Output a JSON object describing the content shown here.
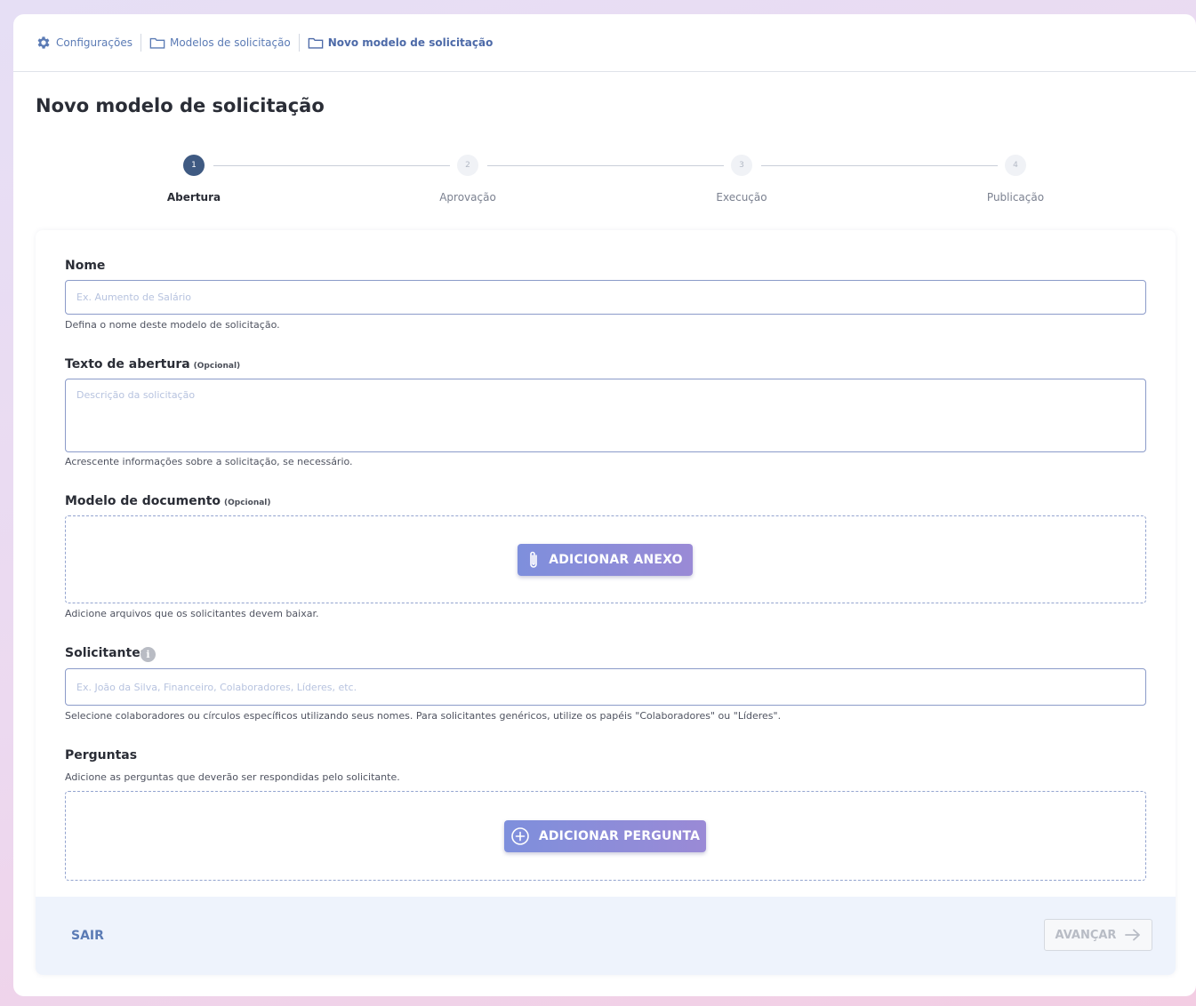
{
  "breadcrumb": [
    {
      "label": "Configurações",
      "icon": "gear-icon"
    },
    {
      "label": "Modelos de solicitação",
      "icon": "folder-icon"
    },
    {
      "label": "Novo modelo de solicitação",
      "icon": "folder-icon"
    }
  ],
  "page": {
    "title": "Novo modelo de solicitação"
  },
  "stepper": {
    "steps": [
      {
        "number": "1",
        "label": "Abertura",
        "active": true
      },
      {
        "number": "2",
        "label": "Aprovação",
        "active": false
      },
      {
        "number": "3",
        "label": "Execução",
        "active": false
      },
      {
        "number": "4",
        "label": "Publicação",
        "active": false
      }
    ]
  },
  "form": {
    "nome": {
      "label": "Nome",
      "placeholder": "Ex. Aumento de Salário",
      "helper": "Defina o nome deste modelo de solicitação."
    },
    "texto_abertura": {
      "label": "Texto de abertura",
      "optional": "(Opcional)",
      "placeholder": "Descrição da solicitação",
      "helper": "Acrescente informações sobre a solicitação, se necessário."
    },
    "modelo_documento": {
      "label": "Modelo de documento",
      "optional": "(Opcional)",
      "button": "ADICIONAR ANEXO",
      "helper": "Adicione arquivos que os solicitantes devem baixar."
    },
    "solicitantes": {
      "label": "Solicitantes",
      "info": "i",
      "placeholder": "Ex. João da Silva, Financeiro, Colaboradores, Líderes, etc.",
      "helper": "Selecione colaboradores ou círculos específicos utilizando seus nomes. Para solicitantes genéricos, utilize os papéis \"Colaboradores\" ou \"Líderes\"."
    },
    "perguntas": {
      "label": "Perguntas",
      "helper": "Adicione as perguntas que deverão ser respondidas pelo solicitante.",
      "button": "ADICIONAR PERGUNTA"
    }
  },
  "footer": {
    "exit": "SAIR",
    "next": "AVANÇAR"
  },
  "colors": {
    "accent": "#5b7bb5",
    "active_step": "#3f5a82",
    "button_gradient_start": "#7e8fdc",
    "button_gradient_end": "#9a8ad6"
  }
}
